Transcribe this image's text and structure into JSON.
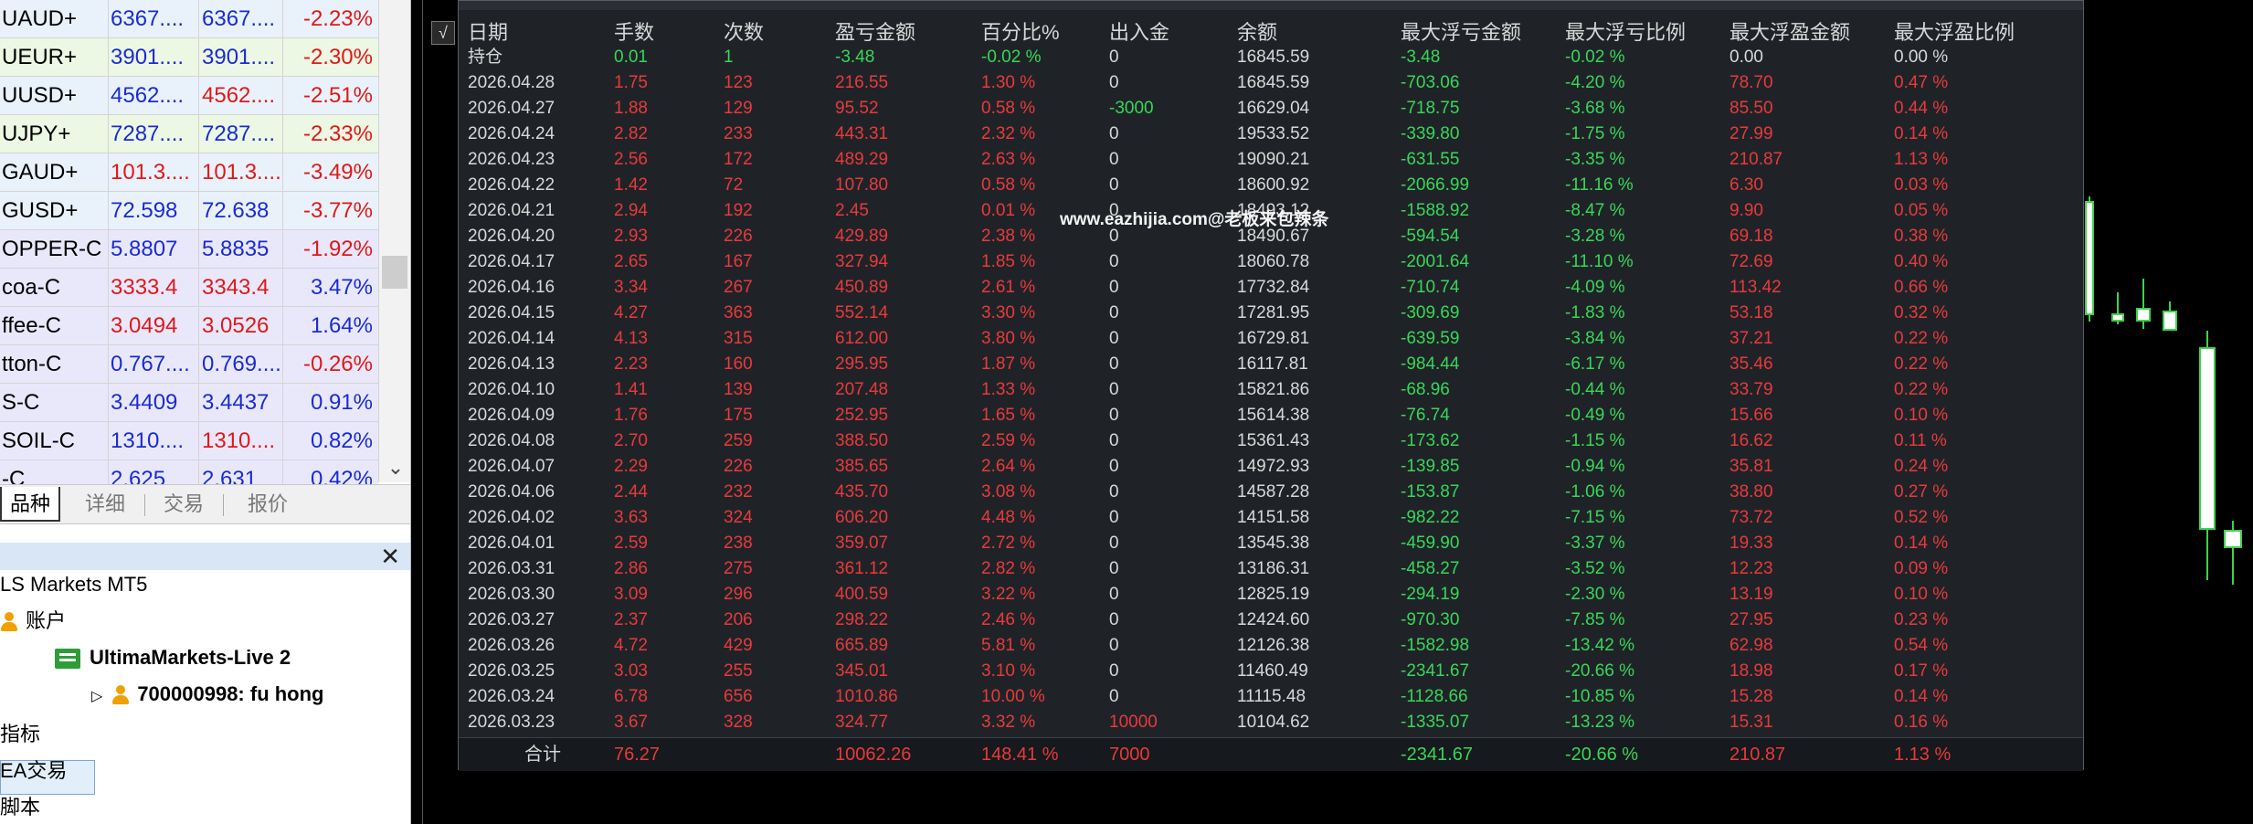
{
  "market_watch": {
    "rows": [
      {
        "symbol": "UAUD+",
        "bid": "6367....",
        "ask": "6367....",
        "change": "-2.23%",
        "bid_color": "blue",
        "ask_color": "blue",
        "change_color": "red",
        "bg": "a"
      },
      {
        "symbol": "UEUR+",
        "bid": "3901....",
        "ask": "3901....",
        "change": "-2.30%",
        "bid_color": "blue",
        "ask_color": "blue",
        "change_color": "red",
        "bg": "b"
      },
      {
        "symbol": "UUSD+",
        "bid": "4562....",
        "ask": "4562....",
        "change": "-2.51%",
        "bid_color": "blue",
        "ask_color": "red",
        "change_color": "red",
        "bg": "a"
      },
      {
        "symbol": "UJPY+",
        "bid": "7287....",
        "ask": "7287....",
        "change": "-2.33%",
        "bid_color": "blue",
        "ask_color": "blue",
        "change_color": "red",
        "bg": "b"
      },
      {
        "symbol": "GAUD+",
        "bid": "101.3....",
        "ask": "101.3....",
        "change": "-3.49%",
        "bid_color": "red",
        "ask_color": "red",
        "change_color": "red",
        "bg": "a"
      },
      {
        "symbol": "GUSD+",
        "bid": "72.598",
        "ask": "72.638",
        "change": "-3.77%",
        "bid_color": "blue",
        "ask_color": "blue",
        "change_color": "red",
        "bg": "a"
      },
      {
        "symbol": "OPPER-C",
        "bid": "5.8807",
        "ask": "5.8835",
        "change": "-1.92%",
        "bid_color": "blue",
        "ask_color": "blue",
        "change_color": "red",
        "bg": "c"
      },
      {
        "symbol": "coa-C",
        "bid": "3333.4",
        "ask": "3343.4",
        "change": "3.47%",
        "bid_color": "red",
        "ask_color": "red",
        "change_color": "blue",
        "bg": "c"
      },
      {
        "symbol": "ffee-C",
        "bid": "3.0494",
        "ask": "3.0526",
        "change": "1.64%",
        "bid_color": "red",
        "ask_color": "red",
        "change_color": "blue",
        "bg": "c"
      },
      {
        "symbol": "tton-C",
        "bid": "0.767....",
        "ask": "0.769....",
        "change": "-0.26%",
        "bid_color": "blue",
        "ask_color": "blue",
        "change_color": "red",
        "bg": "c"
      },
      {
        "symbol": "S-C",
        "bid": "3.4409",
        "ask": "3.4437",
        "change": "0.91%",
        "bid_color": "blue",
        "ask_color": "blue",
        "change_color": "blue",
        "bg": "c"
      },
      {
        "symbol": "SOIL-C",
        "bid": "1310....",
        "ask": "1310....",
        "change": "0.82%",
        "bid_color": "blue",
        "ask_color": "red",
        "change_color": "blue",
        "bg": "c"
      },
      {
        "symbol": "-C",
        "bid": "2.625",
        "ask": "2.631",
        "change": "0.42%",
        "bid_color": "blue",
        "ask_color": "blue",
        "change_color": "blue",
        "bg": "c"
      }
    ],
    "scroll_down_icon": "chevron-down-icon"
  },
  "tabs": [
    "品种",
    "详细",
    "交易",
    "报价"
  ],
  "navigator": {
    "close_label": "✕",
    "items": [
      {
        "label": "LS Markets MT5",
        "indent": 0,
        "icon": "",
        "bold": false
      },
      {
        "label": "账户",
        "indent": 0,
        "icon": "user-icon",
        "bold": false
      },
      {
        "label": "UltimaMarkets-Live 2",
        "indent": 60,
        "icon": "account-icon",
        "bold": true
      },
      {
        "label": "700000998: fu hong",
        "indent": 100,
        "icon": "user-icon",
        "bold": true
      },
      {
        "label": "指标",
        "indent": 0,
        "icon": "",
        "bold": false
      },
      {
        "label": "EA交易",
        "indent": 0,
        "icon": "",
        "bold": false
      },
      {
        "label": "脚本",
        "indent": 0,
        "icon": "",
        "bold": false
      }
    ]
  },
  "stats": {
    "headers": [
      "日期",
      "手数",
      "次数",
      "盈亏金额",
      "百分比%",
      "出入金",
      "余额",
      "最大浮亏金额",
      "最大浮亏比例",
      "最大浮盈金额",
      "最大浮盈比例"
    ],
    "position_row": {
      "date": "持仓",
      "lots": "0.01",
      "count": "1",
      "pnl": "-3.48",
      "pct": "-0.02 %",
      "io": "0",
      "balance": "16845.59",
      "max_dd": "-3.48",
      "max_dd_pct": "-0.02 %",
      "max_fp": "0.00",
      "max_fp_pct": "0.00 %"
    },
    "rows": [
      [
        "2026.04.28",
        "1.75",
        "123",
        "216.55",
        "1.30 %",
        "0",
        "16845.59",
        "-703.06",
        "-4.20 %",
        "78.70",
        "0.47 %"
      ],
      [
        "2026.04.27",
        "1.88",
        "129",
        "95.52",
        "0.58 %",
        "-3000",
        "16629.04",
        "-718.75",
        "-3.68 %",
        "85.50",
        "0.44 %"
      ],
      [
        "2026.04.24",
        "2.82",
        "233",
        "443.31",
        "2.32 %",
        "0",
        "19533.52",
        "-339.80",
        "-1.75 %",
        "27.99",
        "0.14 %"
      ],
      [
        "2026.04.23",
        "2.56",
        "172",
        "489.29",
        "2.63 %",
        "0",
        "19090.21",
        "-631.55",
        "-3.35 %",
        "210.87",
        "1.13 %"
      ],
      [
        "2026.04.22",
        "1.42",
        "72",
        "107.80",
        "0.58 %",
        "0",
        "18600.92",
        "-2066.99",
        "-11.16 %",
        "6.30",
        "0.03 %"
      ],
      [
        "2026.04.21",
        "2.94",
        "192",
        "2.45",
        "0.01 %",
        "0",
        "18493.12",
        "-1588.92",
        "-8.47 %",
        "9.90",
        "0.05 %"
      ],
      [
        "2026.04.20",
        "2.93",
        "226",
        "429.89",
        "2.38 %",
        "0",
        "18490.67",
        "-594.54",
        "-3.28 %",
        "69.18",
        "0.38 %"
      ],
      [
        "2026.04.17",
        "2.65",
        "167",
        "327.94",
        "1.85 %",
        "0",
        "18060.78",
        "-2001.64",
        "-11.10 %",
        "72.69",
        "0.40 %"
      ],
      [
        "2026.04.16",
        "3.34",
        "267",
        "450.89",
        "2.61 %",
        "0",
        "17732.84",
        "-710.74",
        "-4.09 %",
        "113.42",
        "0.66 %"
      ],
      [
        "2026.04.15",
        "4.27",
        "363",
        "552.14",
        "3.30 %",
        "0",
        "17281.95",
        "-309.69",
        "-1.83 %",
        "53.18",
        "0.32 %"
      ],
      [
        "2026.04.14",
        "4.13",
        "315",
        "612.00",
        "3.80 %",
        "0",
        "16729.81",
        "-639.59",
        "-3.84 %",
        "37.21",
        "0.22 %"
      ],
      [
        "2026.04.13",
        "2.23",
        "160",
        "295.95",
        "1.87 %",
        "0",
        "16117.81",
        "-984.44",
        "-6.17 %",
        "35.46",
        "0.22 %"
      ],
      [
        "2026.04.10",
        "1.41",
        "139",
        "207.48",
        "1.33 %",
        "0",
        "15821.86",
        "-68.96",
        "-0.44 %",
        "33.79",
        "0.22 %"
      ],
      [
        "2026.04.09",
        "1.76",
        "175",
        "252.95",
        "1.65 %",
        "0",
        "15614.38",
        "-76.74",
        "-0.49 %",
        "15.66",
        "0.10 %"
      ],
      [
        "2026.04.08",
        "2.70",
        "259",
        "388.50",
        "2.59 %",
        "0",
        "15361.43",
        "-173.62",
        "-1.15 %",
        "16.62",
        "0.11 %"
      ],
      [
        "2026.04.07",
        "2.29",
        "226",
        "385.65",
        "2.64 %",
        "0",
        "14972.93",
        "-139.85",
        "-0.94 %",
        "35.81",
        "0.24 %"
      ],
      [
        "2026.04.06",
        "2.44",
        "232",
        "435.70",
        "3.08 %",
        "0",
        "14587.28",
        "-153.87",
        "-1.06 %",
        "38.80",
        "0.27 %"
      ],
      [
        "2026.04.02",
        "3.63",
        "324",
        "606.20",
        "4.48 %",
        "0",
        "14151.58",
        "-982.22",
        "-7.15 %",
        "73.72",
        "0.52 %"
      ],
      [
        "2026.04.01",
        "2.59",
        "238",
        "359.07",
        "2.72 %",
        "0",
        "13545.38",
        "-459.90",
        "-3.37 %",
        "19.33",
        "0.14 %"
      ],
      [
        "2026.03.31",
        "2.86",
        "275",
        "361.12",
        "2.82 %",
        "0",
        "13186.31",
        "-458.27",
        "-3.52 %",
        "12.23",
        "0.09 %"
      ],
      [
        "2026.03.30",
        "3.09",
        "296",
        "400.59",
        "3.22 %",
        "0",
        "12825.19",
        "-294.19",
        "-2.30 %",
        "13.19",
        "0.10 %"
      ],
      [
        "2026.03.27",
        "2.37",
        "206",
        "298.22",
        "2.46 %",
        "0",
        "12424.60",
        "-970.30",
        "-7.85 %",
        "27.95",
        "0.23 %"
      ],
      [
        "2026.03.26",
        "4.72",
        "429",
        "665.89",
        "5.81 %",
        "0",
        "12126.38",
        "-1582.98",
        "-13.42 %",
        "62.98",
        "0.54 %"
      ],
      [
        "2026.03.25",
        "3.03",
        "255",
        "345.01",
        "3.10 %",
        "0",
        "11460.49",
        "-2341.67",
        "-20.66 %",
        "18.98",
        "0.17 %"
      ],
      [
        "2026.03.24",
        "6.78",
        "656",
        "1010.86",
        "10.00 %",
        "0",
        "11115.48",
        "-1128.66",
        "-10.85 %",
        "15.28",
        "0.14 %"
      ],
      [
        "2026.03.23",
        "3.67",
        "328",
        "324.77",
        "3.32 %",
        "10000",
        "10104.62",
        "-1335.07",
        "-13.23 %",
        "15.31",
        "0.16 %"
      ]
    ],
    "totals": {
      "label": "合计",
      "lots": "76.27",
      "pnl": "10062.26",
      "pct": "148.41 %",
      "io": "7000",
      "max_dd": "-2341.67",
      "max_dd_pct": "-20.66 %",
      "max_fp": "210.87",
      "max_fp_pct": "1.13 %"
    }
  },
  "watermark": "www.eazhijia.com@老板来包辣条",
  "colors": {
    "profit": "#e83a3a",
    "loss": "#39d657",
    "text": "#d8d8d8",
    "panel_bg": "#1f2328",
    "candle_up": "#3fd24b",
    "bid_blue": "#1a2bd0",
    "change_red": "#e01818"
  }
}
